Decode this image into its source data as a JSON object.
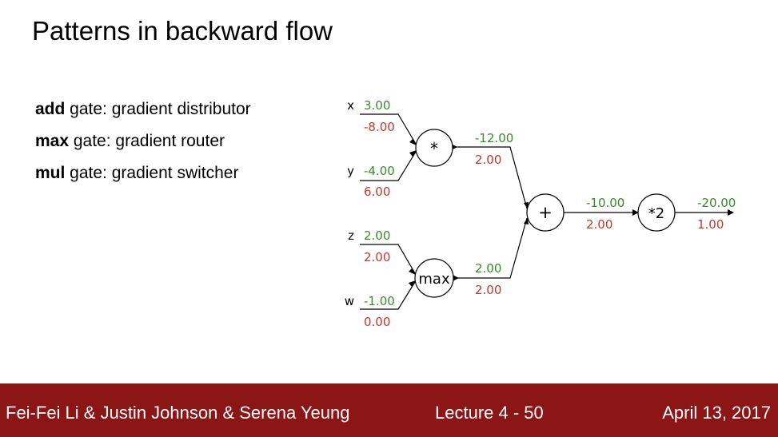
{
  "slide": {
    "title": "Patterns in backward flow",
    "bullets": [
      {
        "bold": "add",
        "rest": " gate: gradient distributor"
      },
      {
        "bold": "max",
        "rest": " gate: gradient router"
      },
      {
        "bold": "mul",
        "rest": " gate: gradient switcher"
      }
    ]
  },
  "colors": {
    "forward": "#3a8a2a",
    "backward": "#c0392b",
    "footer_bg": "#8c1515"
  },
  "graph": {
    "inputs": [
      {
        "name": "x",
        "value": "3.00",
        "grad": "-8.00"
      },
      {
        "name": "y",
        "value": "-4.00",
        "grad": "6.00"
      },
      {
        "name": "z",
        "value": "2.00",
        "grad": "2.00"
      },
      {
        "name": "w",
        "value": "-1.00",
        "grad": "0.00"
      }
    ],
    "nodes": {
      "mul": "*",
      "max": "max",
      "add": "+",
      "scale": "*2"
    },
    "edges": {
      "mul_out": {
        "value": "-12.00",
        "grad": "2.00"
      },
      "max_out": {
        "value": "2.00",
        "grad": "2.00"
      },
      "add_out": {
        "value": "-10.00",
        "grad": "2.00"
      },
      "final_out": {
        "value": "-20.00",
        "grad": "1.00"
      }
    }
  },
  "footer": {
    "authors": "Fei-Fei Li & Justin Johnson & Serena Yeung",
    "lecture": "Lecture 4 - 50",
    "date": "April 13, 2017"
  }
}
